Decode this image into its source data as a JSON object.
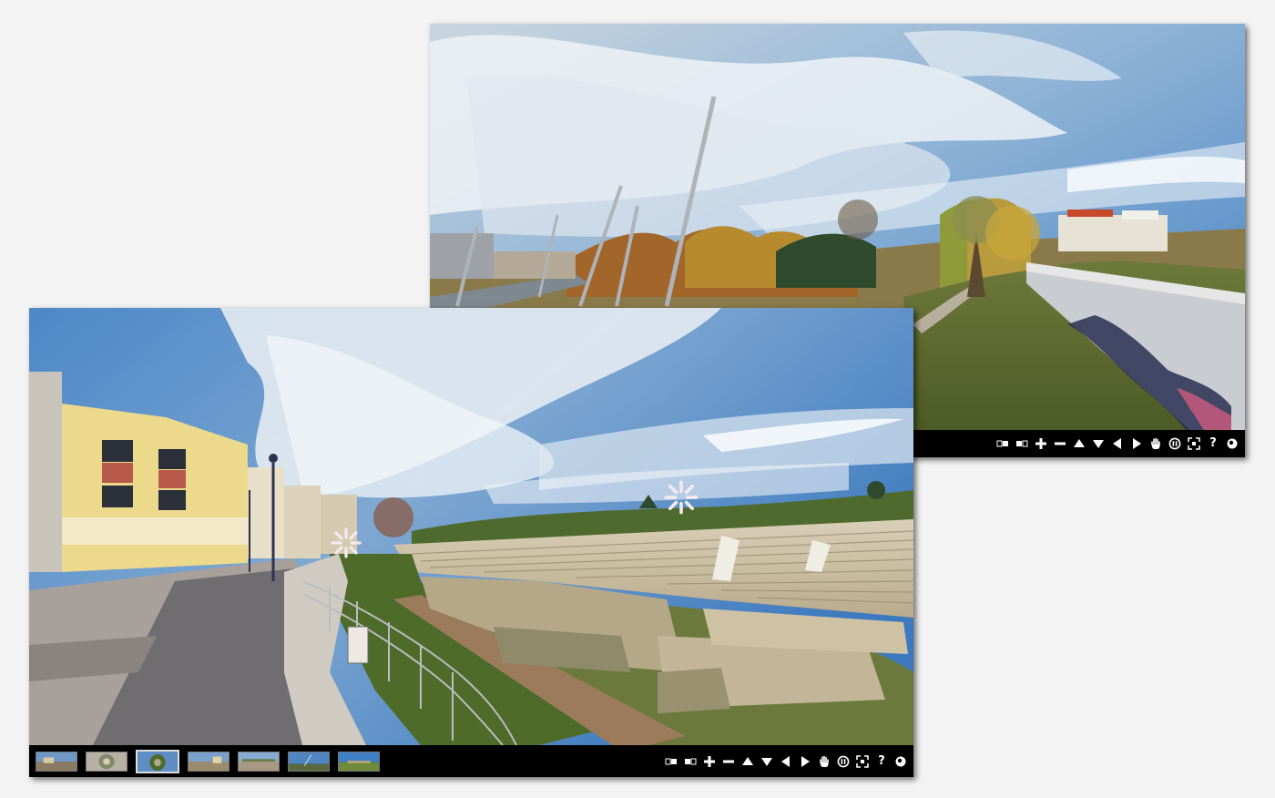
{
  "colors": {
    "background": "#f3f3f3",
    "bar": "#000000",
    "control_icon": "#ffffff",
    "hotspot": "#ffffff"
  },
  "back_viewer": {
    "controls": [
      "toggle-mode-left-icon",
      "toggle-mode-right-icon",
      "zoom-in-icon",
      "zoom-out-icon",
      "pan-up-icon",
      "pan-down-icon",
      "pan-left-icon",
      "pan-right-icon",
      "hand-drag-icon",
      "autorotate-icon",
      "fullscreen-icon",
      "help-icon",
      "info-icon"
    ],
    "help_label": "?"
  },
  "front_viewer": {
    "thumbnails": [
      {
        "scene": "street-plaza"
      },
      {
        "scene": "little-planet-square"
      },
      {
        "scene": "little-planet-park",
        "active": true
      },
      {
        "scene": "street-buildings"
      },
      {
        "scene": "riverside-road"
      },
      {
        "scene": "bridge-sky"
      },
      {
        "scene": "open-field"
      }
    ],
    "controls": [
      "toggle-mode-left-icon",
      "toggle-mode-right-icon",
      "zoom-in-icon",
      "zoom-out-icon",
      "pan-up-icon",
      "pan-down-icon",
      "pan-left-icon",
      "pan-right-icon",
      "hand-drag-icon",
      "autorotate-icon",
      "fullscreen-icon",
      "help-icon",
      "info-icon"
    ],
    "help_label": "?",
    "hotspots": [
      "navigation-hotspot-icon",
      "navigation-hotspot-icon"
    ]
  }
}
